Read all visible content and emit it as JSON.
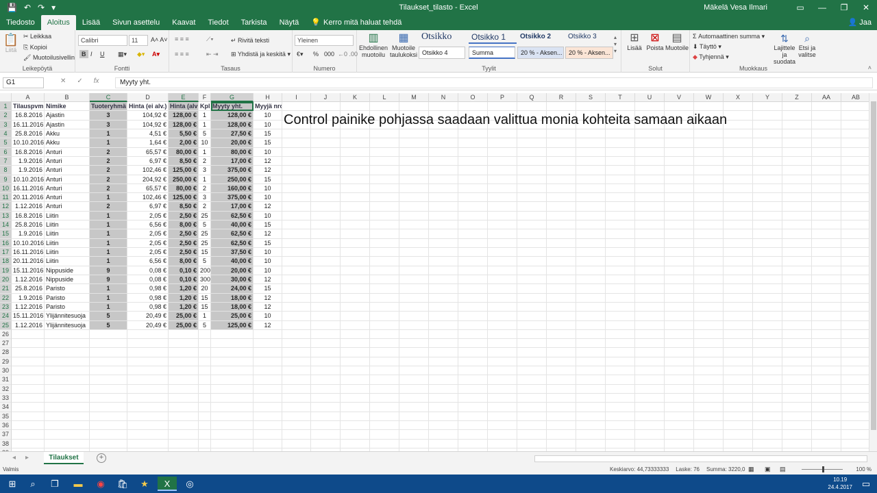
{
  "window": {
    "title": "Tilaukset_tilasto - Excel",
    "user": "Mäkelä Vesa Ilmari",
    "share": "Jaa"
  },
  "tabs": [
    "Tiedosto",
    "Aloitus",
    "Lisää",
    "Sivun asettelu",
    "Kaavat",
    "Tiedot",
    "Tarkista",
    "Näytä"
  ],
  "tellme": "Kerro mitä haluat tehdä",
  "ribbon": {
    "clipboard": {
      "paste": "Liitä",
      "cut": "Leikkaa",
      "copy": "Kopioi",
      "format_painter": "Muotoilusivellin",
      "label": "Leikepöytä"
    },
    "font": {
      "name": "Calibri",
      "size": "11",
      "bold": "B",
      "italic": "I",
      "underline": "U",
      "label": "Fontti"
    },
    "alignment": {
      "wrap": "Rivitä teksti",
      "merge": "Yhdistä ja keskitä",
      "label": "Tasaus"
    },
    "number": {
      "format": "Yleinen",
      "percent": "%",
      "thousands": "000",
      "label": "Numero"
    },
    "styles": {
      "conditional": "Ehdollinen muotoilu",
      "as_table": "Muotoile taulukoksi",
      "cells": [
        "Otsikko",
        "Otsikko 1",
        "Otsikko 2",
        "Otsikko 3",
        "Otsikko 4",
        "Summa",
        "20 % - Aksen...",
        "20 % - Aksen..."
      ],
      "label": "Tyylit"
    },
    "cells": {
      "insert": "Lisää",
      "delete": "Poista",
      "format": "Muotoile",
      "label": "Solut"
    },
    "editing": {
      "autosum": "Automaattinen summa",
      "fill": "Täyttö",
      "clear": "Tyhjennä",
      "sort": "Lajittele ja suodata",
      "find": "Etsi ja valitse",
      "label": "Muokkaus"
    }
  },
  "formula_bar": {
    "name_box": "G1",
    "cancel": "✕",
    "enter": "✓",
    "fx": "fx",
    "content": "Myyty yht."
  },
  "columns": [
    "A",
    "B",
    "C",
    "D",
    "E",
    "F",
    "G",
    "H",
    "I",
    "J",
    "K",
    "L",
    "M",
    "N",
    "O",
    "P",
    "Q",
    "R",
    "S",
    "T",
    "U",
    "V",
    "W",
    "X",
    "Y",
    "Z",
    "AA",
    "AB"
  ],
  "headers": [
    "Tilauspvm",
    "Nimike",
    "Tuoteryhmä",
    "Hinta (ei alv.)",
    "Hinta (alv",
    "Kpl",
    "Myyty yht.",
    "Myyjä nro"
  ],
  "rows": [
    [
      "16.8.2016",
      "Ajastin",
      "3",
      "104,92 €",
      "128,00 €",
      "1",
      "128,00 €",
      "10"
    ],
    [
      "16.11.2016",
      "Ajastin",
      "3",
      "104,92 €",
      "128,00 €",
      "1",
      "128,00 €",
      "10"
    ],
    [
      "25.8.2016",
      "Akku",
      "1",
      "4,51 €",
      "5,50 €",
      "5",
      "27,50 €",
      "15"
    ],
    [
      "10.10.2016",
      "Akku",
      "1",
      "1,64 €",
      "2,00 €",
      "10",
      "20,00 €",
      "15"
    ],
    [
      "16.8.2016",
      "Anturi",
      "2",
      "65,57 €",
      "80,00 €",
      "1",
      "80,00 €",
      "10"
    ],
    [
      "1.9.2016",
      "Anturi",
      "2",
      "6,97 €",
      "8,50 €",
      "2",
      "17,00 €",
      "12"
    ],
    [
      "1.9.2016",
      "Anturi",
      "2",
      "102,46 €",
      "125,00 €",
      "3",
      "375,00 €",
      "12"
    ],
    [
      "10.10.2016",
      "Anturi",
      "2",
      "204,92 €",
      "250,00 €",
      "1",
      "250,00 €",
      "15"
    ],
    [
      "16.11.2016",
      "Anturi",
      "2",
      "65,57 €",
      "80,00 €",
      "2",
      "160,00 €",
      "10"
    ],
    [
      "20.11.2016",
      "Anturi",
      "1",
      "102,46 €",
      "125,00 €",
      "3",
      "375,00 €",
      "10"
    ],
    [
      "1.12.2016",
      "Anturi",
      "2",
      "6,97 €",
      "8,50 €",
      "2",
      "17,00 €",
      "12"
    ],
    [
      "16.8.2016",
      "Liitin",
      "1",
      "2,05 €",
      "2,50 €",
      "25",
      "62,50 €",
      "10"
    ],
    [
      "25.8.2016",
      "Liitin",
      "1",
      "6,56 €",
      "8,00 €",
      "5",
      "40,00 €",
      "15"
    ],
    [
      "1.9.2016",
      "Liitin",
      "1",
      "2,05 €",
      "2,50 €",
      "25",
      "62,50 €",
      "12"
    ],
    [
      "10.10.2016",
      "Liitin",
      "1",
      "2,05 €",
      "2,50 €",
      "25",
      "62,50 €",
      "15"
    ],
    [
      "16.11.2016",
      "Liitin",
      "1",
      "2,05 €",
      "2,50 €",
      "15",
      "37,50 €",
      "10"
    ],
    [
      "20.11.2016",
      "Liitin",
      "1",
      "6,56 €",
      "8,00 €",
      "5",
      "40,00 €",
      "10"
    ],
    [
      "15.11.2016",
      "Nippuside",
      "9",
      "0,08 €",
      "0,10 €",
      "200",
      "20,00 €",
      "10"
    ],
    [
      "1.12.2016",
      "Nippuside",
      "9",
      "0,08 €",
      "0,10 €",
      "300",
      "30,00 €",
      "12"
    ],
    [
      "25.8.2016",
      "Paristo",
      "1",
      "0,98 €",
      "1,20 €",
      "20",
      "24,00 €",
      "15"
    ],
    [
      "1.9.2016",
      "Paristo",
      "1",
      "0,98 €",
      "1,20 €",
      "15",
      "18,00 €",
      "12"
    ],
    [
      "1.12.2016",
      "Paristo",
      "1",
      "0,98 €",
      "1,20 €",
      "15",
      "18,00 €",
      "12"
    ],
    [
      "15.11.2016",
      "Ylijännitesuoja",
      "5",
      "20,49 €",
      "25,00 €",
      "1",
      "25,00 €",
      "10"
    ],
    [
      "1.12.2016",
      "Ylijännitesuoja",
      "5",
      "20,49 €",
      "25,00 €",
      "5",
      "125,00 €",
      "12"
    ]
  ],
  "overlay_note": "Control painike pohjassa saadaan valittua monia kohteita samaan aikaan",
  "sheet": {
    "tab": "Tilaukset"
  },
  "status": {
    "ready": "Valmis",
    "average": "Keskiarvo: 44,73333333",
    "count": "Laske: 76",
    "sum": "Summa: 3220,0",
    "zoom": "100 %"
  },
  "taskbar": {
    "time": "10.19",
    "date": "24.4.2017"
  },
  "colors": {
    "accent": "#217346",
    "selection": "#c7c7c7"
  }
}
